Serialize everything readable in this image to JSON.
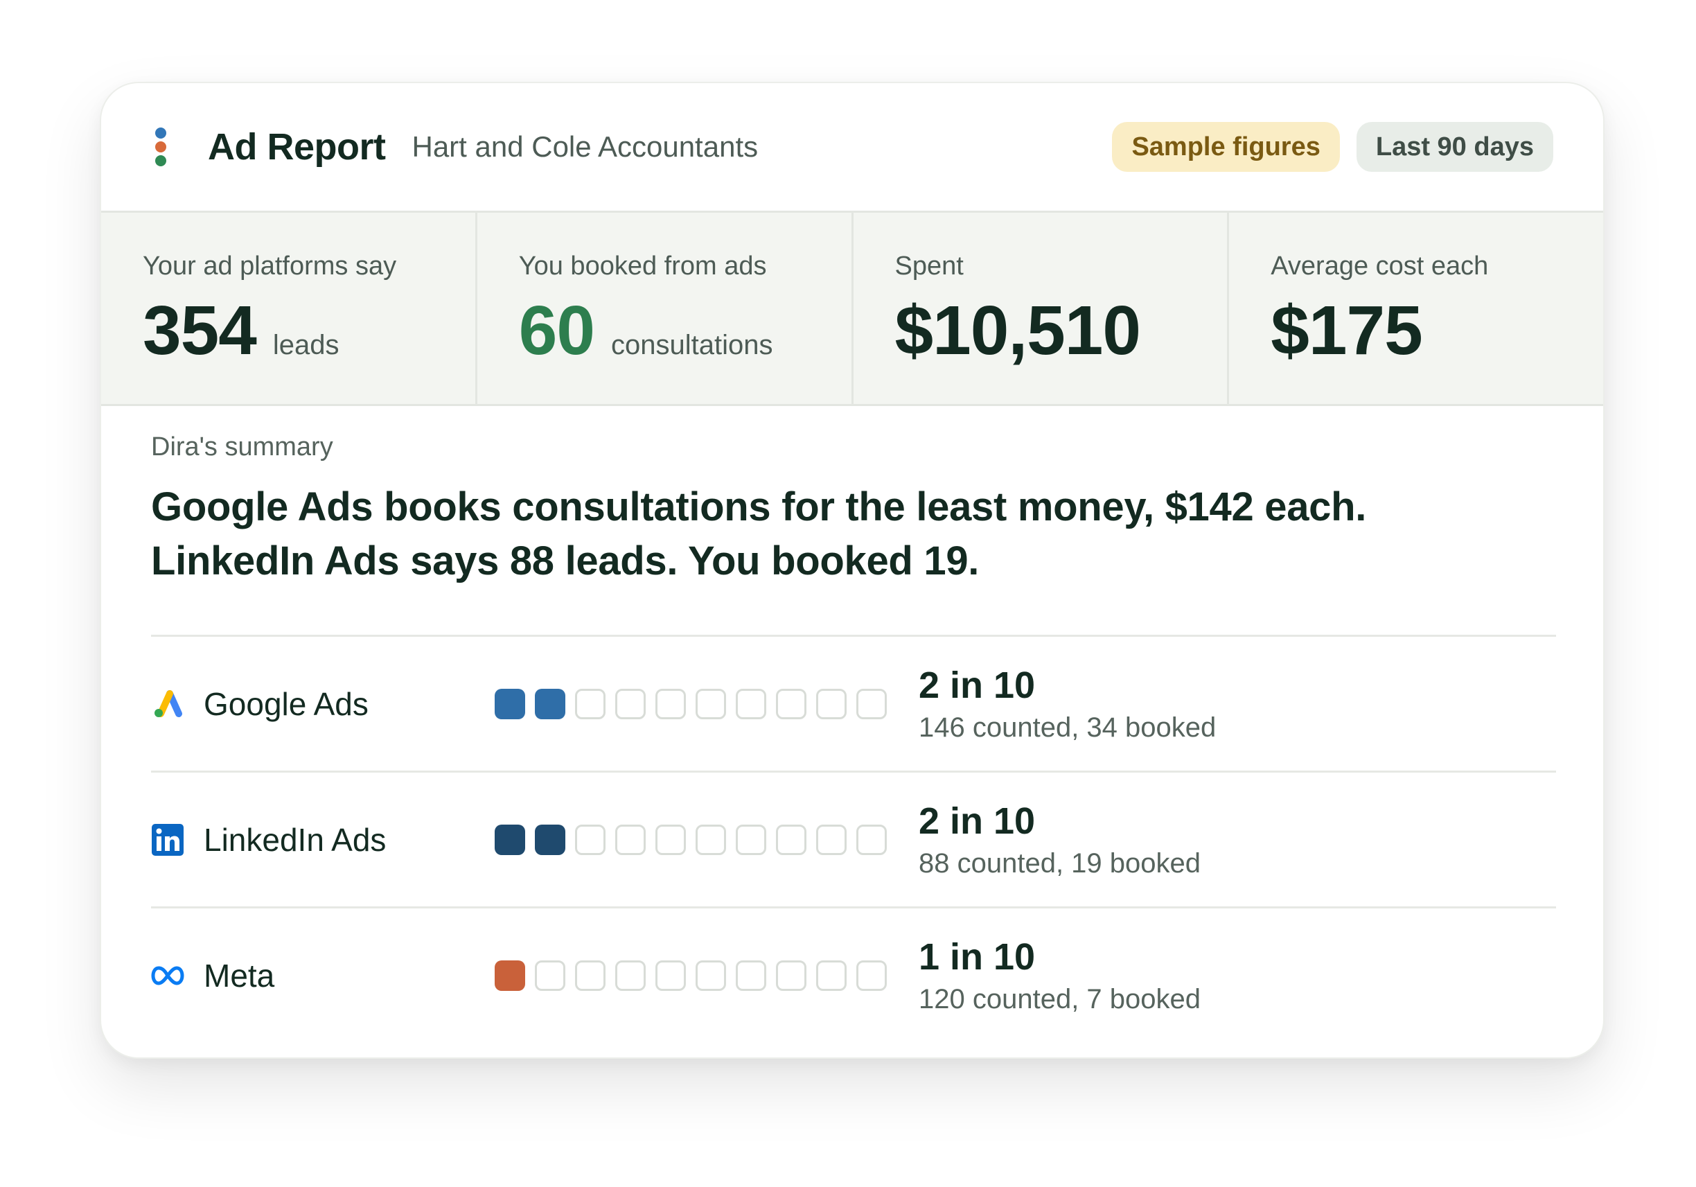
{
  "header": {
    "app_title": "Ad Report",
    "client": "Hart and Cole Accountants",
    "badge_sample": "Sample figures",
    "badge_range": "Last 90 days"
  },
  "stats": [
    {
      "label": "Your ad platforms say",
      "value": "354",
      "unit": "leads",
      "highlight": false
    },
    {
      "label": "You booked from ads",
      "value": "60",
      "unit": "consultations",
      "highlight": true
    },
    {
      "label": "Spent",
      "value": "$10,510",
      "unit": "",
      "highlight": false
    },
    {
      "label": "Average cost each",
      "value": "$175",
      "unit": "",
      "highlight": false
    }
  ],
  "summary": {
    "label": "Dira's summary",
    "line1": "Google Ads books consultations for the least money, $142 each.",
    "line2": "LinkedIn Ads says 88 leads. You booked 19."
  },
  "platforms": [
    {
      "name": "Google Ads",
      "icon": "google-ads-icon",
      "filled": 2,
      "total": 10,
      "color": "#2f6ea8",
      "ratio": "2 in 10",
      "detail": "146 counted, 34 booked"
    },
    {
      "name": "LinkedIn Ads",
      "icon": "linkedin-icon",
      "filled": 2,
      "total": 10,
      "color": "#1f4a6e",
      "ratio": "2 in 10",
      "detail": "88 counted, 19 booked"
    },
    {
      "name": "Meta",
      "icon": "meta-icon",
      "filled": 1,
      "total": 10,
      "color": "#c9613a",
      "ratio": "1 in 10",
      "detail": "120 counted, 7 booked"
    }
  ],
  "colors": {
    "accent_green": "#2d7e4e",
    "badge_sample_bg": "#faedc5",
    "badge_range_bg": "#e8ede8"
  }
}
